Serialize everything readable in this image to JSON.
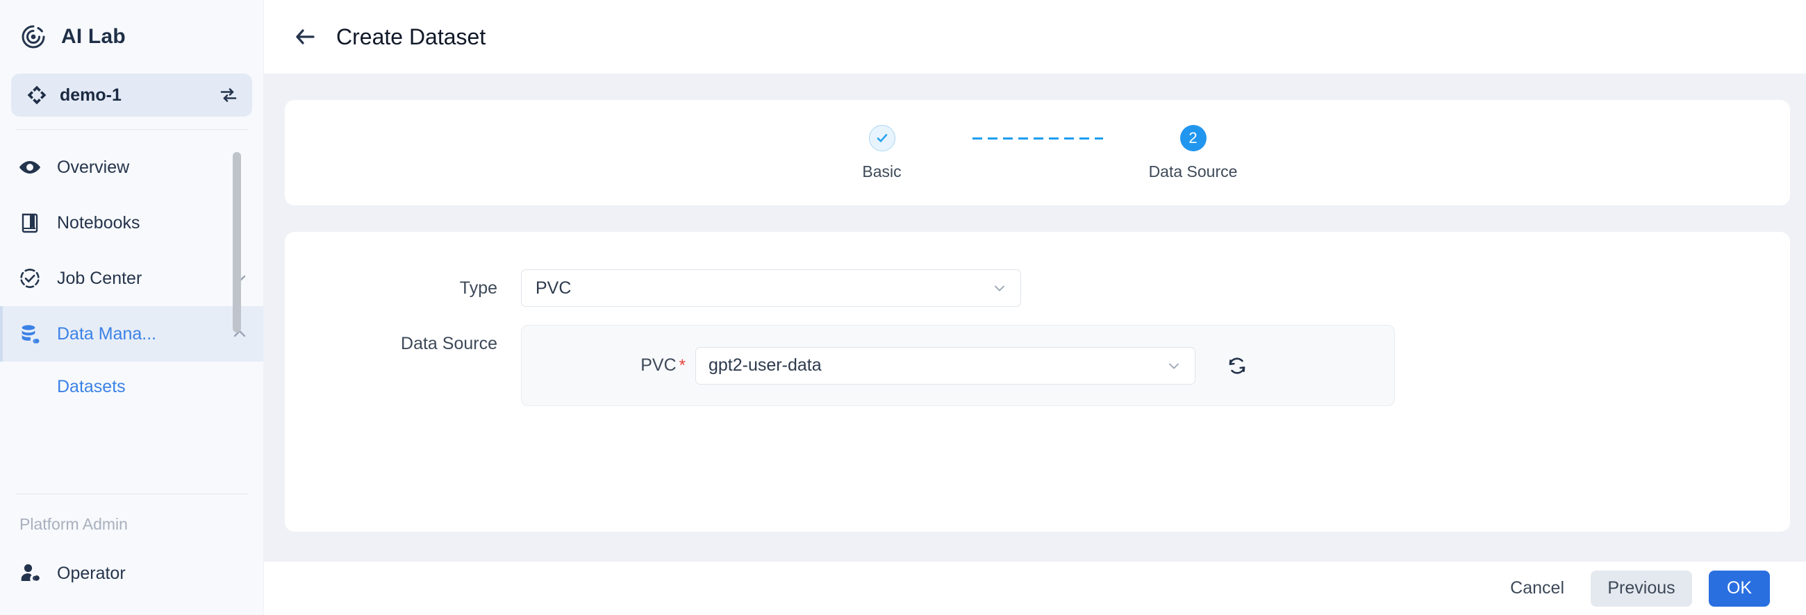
{
  "sidebar": {
    "brand": {
      "name": "AI Lab",
      "logo_icon": "target-rings-icon"
    },
    "project": {
      "name": "demo-1",
      "icon": "project-diamond-icon",
      "switch_icon": "switch-arrows-icon"
    },
    "items": [
      {
        "label": "Overview",
        "icon": "eye-icon",
        "active": false,
        "chevron": ""
      },
      {
        "label": "Notebooks",
        "icon": "book-icon",
        "active": false,
        "chevron": ""
      },
      {
        "label": "Job Center",
        "icon": "check-circle-dashed-icon",
        "active": false,
        "chevron": "chevron-down-icon"
      },
      {
        "label": "Data Mana...",
        "icon": "database-gear-icon",
        "active": true,
        "chevron": "chevron-up-icon"
      }
    ],
    "sub_items": [
      {
        "label": "Datasets",
        "active": true
      }
    ],
    "section_label": "Platform Admin",
    "admin_items": [
      {
        "label": "Operator",
        "icon": "user-gear-icon"
      }
    ]
  },
  "topbar": {
    "back_icon": "arrow-left-icon",
    "title": "Create Dataset"
  },
  "stepper": {
    "steps": [
      {
        "label": "Basic",
        "state": "done",
        "indicator": "check-icon"
      },
      {
        "label": "Data Source",
        "state": "current",
        "indicator": "2"
      }
    ]
  },
  "form": {
    "type_row": {
      "label": "Type",
      "value": "PVC",
      "caret_icon": "chevron-down-icon"
    },
    "data_source_row": {
      "label": "Data Source",
      "pvc": {
        "label": "PVC",
        "required_mark": "*",
        "value": "gpt2-user-data",
        "caret_icon": "chevron-down-icon",
        "refresh_icon": "refresh-icon"
      }
    }
  },
  "footer": {
    "cancel_label": "Cancel",
    "previous_label": "Previous",
    "ok_label": "OK"
  },
  "colors": {
    "accent_blue": "#3b82e6",
    "primary_button": "#2a6fe0",
    "step_current": "#2196ef",
    "required_red": "#e8413c",
    "sidebar_bg": "#f7f9fc",
    "content_bg": "#eff1f6"
  }
}
